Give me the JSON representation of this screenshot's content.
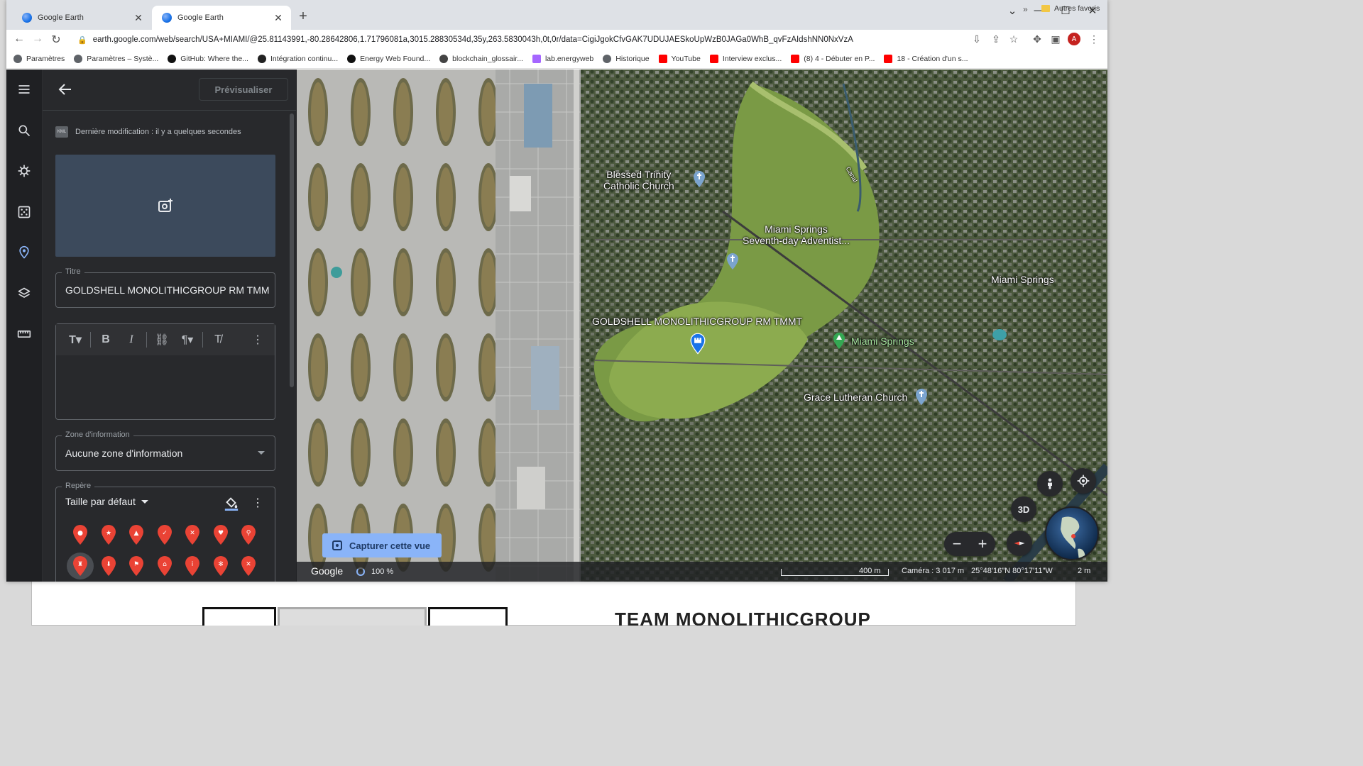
{
  "browser": {
    "tabs": [
      {
        "title": "Google Earth",
        "active": false
      },
      {
        "title": "Google Earth",
        "active": true
      }
    ],
    "url": "earth.google.com/web/search/USA+MIAMI/@25.81143991,-80.28642806,1.71796081a,3015.28830534d,35y,263.5830043h,0t,0r/data=CigiJgokCfvGAK7UDUJAESkoUpWzB0JAGa0WhB_qvFzAIdshNN0NxVzA",
    "profile_initial": "A",
    "bookmarks": [
      {
        "label": "Paramètres",
        "icon": "gear-icon",
        "color": "#5f6368"
      },
      {
        "label": "Paramètres – Systè...",
        "icon": "gear-icon",
        "color": "#5f6368"
      },
      {
        "label": "GitHub: Where the...",
        "icon": "github-icon",
        "color": "#111111"
      },
      {
        "label": "Intégration continu...",
        "icon": "ci-icon",
        "color": "#222222"
      },
      {
        "label": "Energy Web Found...",
        "icon": "github-icon",
        "color": "#111111"
      },
      {
        "label": "blockchain_glossair...",
        "icon": "globe-icon",
        "color": "#444444"
      },
      {
        "label": "lab.energyweb",
        "icon": "energyweb-icon",
        "color": "#a566ff"
      },
      {
        "label": "Historique",
        "icon": "history-icon",
        "color": "#5f6368"
      },
      {
        "label": "YouTube",
        "icon": "youtube-icon",
        "color": "#ff0000"
      },
      {
        "label": "Interview exclus...",
        "icon": "youtube-icon",
        "color": "#ff0000"
      },
      {
        "label": "(8) 4 - Débuter en P...",
        "icon": "youtube-icon",
        "color": "#ff0000"
      },
      {
        "label": "18 - Création d'un s...",
        "icon": "youtube-icon",
        "color": "#ff0000"
      }
    ],
    "more_bookmarks": "»",
    "other_bookmarks": "Autres favoris"
  },
  "panel": {
    "preview_button": "Prévisualiser",
    "last_modified": "Dernière modification : il y a quelques secondes",
    "kml_badge": "KML",
    "title_label": "Titre",
    "title_value": "GOLDSHELL MONOLITHICGROUP RM TMM",
    "info_label": "Zone d'information",
    "info_value": "Aucune zone d'information",
    "marker_label": "Repère",
    "size_value": "Taille par défaut",
    "marker_icons": [
      "pin-icon",
      "star-pin-icon",
      "warning-pin-icon",
      "check-pin-icon",
      "restaurant-pin-icon",
      "heart-pin-icon",
      "hiking-pin-icon",
      "castle-pin-icon",
      "download-pin-icon",
      "flag-pin-icon",
      "home-pin-icon",
      "info-pin-icon",
      "snowflake-pin-icon",
      "close-pin-icon"
    ],
    "selected_marker": "castle-pin-icon",
    "accent_color": "#8ab4f8",
    "pin_color": "#ea4335"
  },
  "map": {
    "labels": {
      "church1": "Blessed Trinity\nCatholic Church",
      "adventist": "Miami Springs\nSeventh-day Adventist...",
      "springs_city": "Miami Springs",
      "goldshell": "GOLDSHELL MONOLITHICGROUP RM TMMT",
      "springs_park": "Miami Springs",
      "lutheran": "Grace Lutheran Church",
      "canal": "Canal"
    },
    "capture_button": "Capturer cette vue",
    "three_d": "3D",
    "zoom_out": "−",
    "zoom_in": "+",
    "status": {
      "logo": "Google",
      "loading": "100 %",
      "scale": "400 m",
      "camera": "Caméra : 3 017 m",
      "coords": "25°48'16\"N 80°17'11\"W",
      "altitude": "2 m"
    }
  },
  "background_page": {
    "heading": "TEAM MONOLITHICGROUP"
  }
}
